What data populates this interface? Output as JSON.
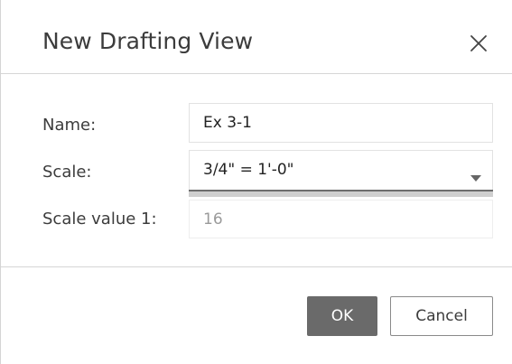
{
  "dialog": {
    "title": "New Drafting View",
    "close_icon": "close-icon"
  },
  "form": {
    "name_label": "Name:",
    "name_value": "Ex 3-1",
    "scale_label": "Scale:",
    "scale_selected": "3/4\" = 1'-0\"",
    "scale_dropdown_icon": "caret-down-icon",
    "scale_value_label": "Scale value  1:",
    "scale_value": "16"
  },
  "buttons": {
    "ok_label": "OK",
    "cancel_label": "Cancel"
  },
  "colors": {
    "primary_button": "#6a6a6a",
    "divider": "#d6d6d6"
  }
}
